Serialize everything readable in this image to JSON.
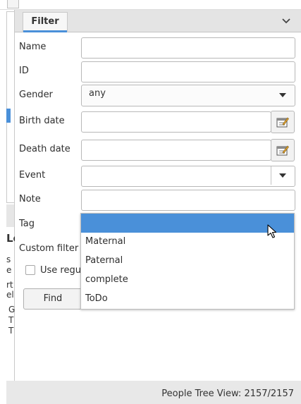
{
  "filter": {
    "tab_label": "Filter",
    "fields": {
      "name": {
        "label": "Name",
        "value": ""
      },
      "id": {
        "label": "ID",
        "value": ""
      },
      "gender": {
        "label": "Gender",
        "value": "any"
      },
      "birth_date": {
        "label": "Birth date",
        "value": ""
      },
      "death_date": {
        "label": "Death date",
        "value": ""
      },
      "event": {
        "label": "Event",
        "value": ""
      },
      "note": {
        "label": "Note",
        "value": ""
      },
      "tag": {
        "label": "Tag",
        "value": ""
      },
      "custom_filter": {
        "label": "Custom filter"
      }
    },
    "regex_label": "Use regu",
    "find_label": "Find"
  },
  "tag_dropdown": {
    "options": [
      "",
      "Maternal",
      "Paternal",
      "complete",
      "ToDo"
    ],
    "selected_index": 0
  },
  "left_pane_fragments": {
    "heading": "Lo",
    "lines": [
      "s",
      "e",
      "rt",
      "el",
      "G",
      "T",
      "T"
    ]
  },
  "status": {
    "text": "People Tree View: 2157/2157"
  },
  "colors": {
    "accent": "#4a90d9",
    "status_bg": "#e8e8e8",
    "header_bg": "#e4e4e4"
  },
  "icons": {
    "collapse": "chevron-down-icon",
    "calendar": "calendar-edit-icon",
    "pointer": "mouse-cursor-icon"
  }
}
